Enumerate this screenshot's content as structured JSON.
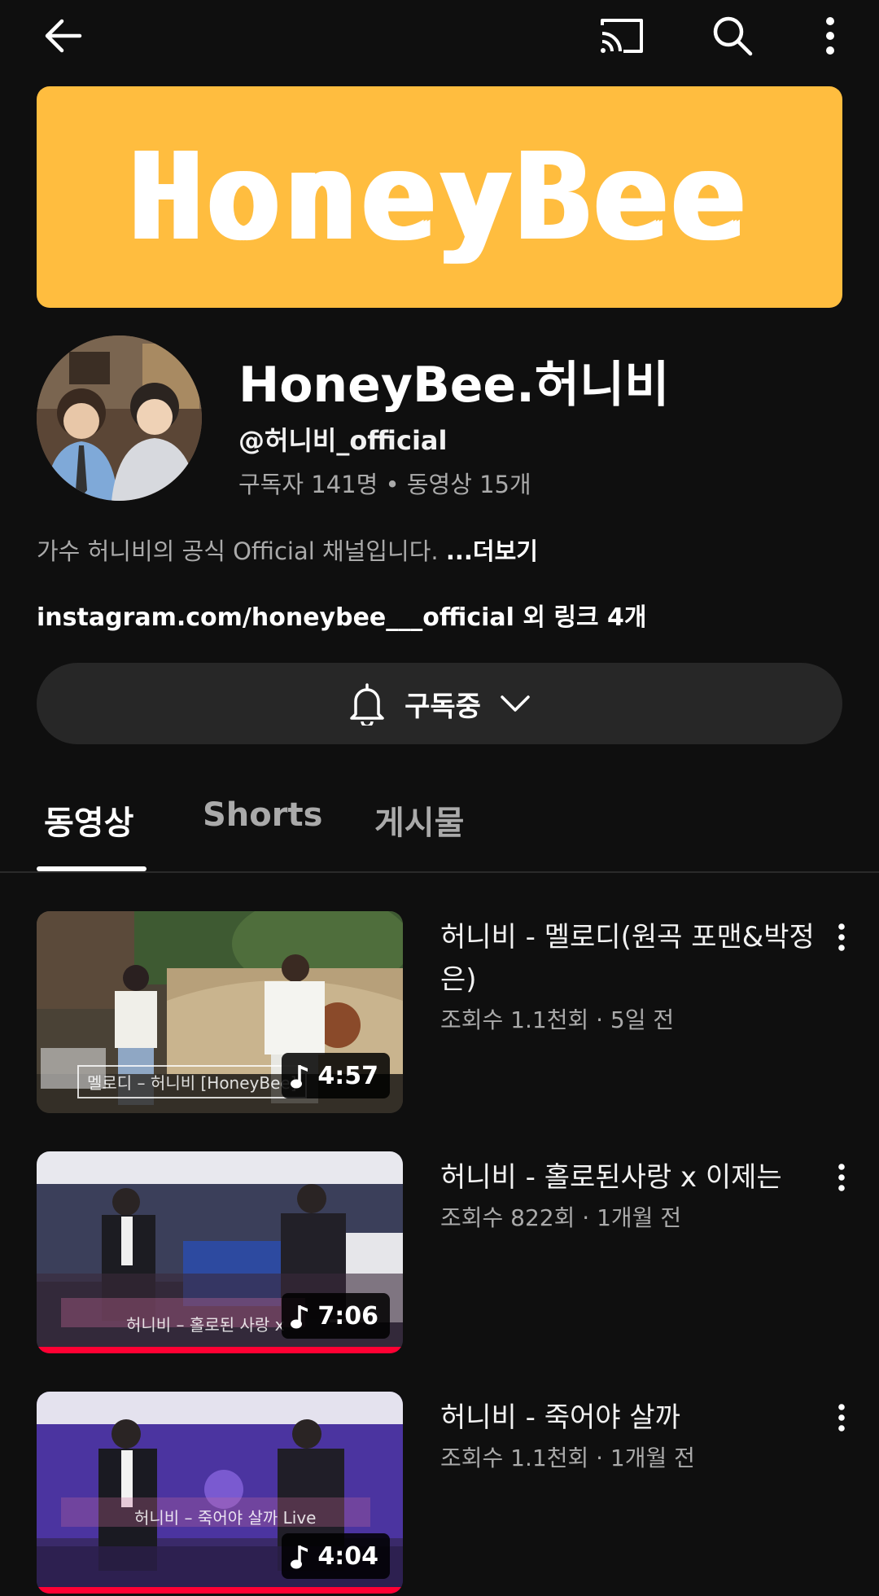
{
  "topbar": {
    "back_icon": "arrow-left-icon",
    "cast_icon": "cast-icon",
    "search_icon": "search-icon",
    "more_icon": "more-vertical-icon"
  },
  "banner": {
    "logo_text": "HoneyBee",
    "bg_color": "#ffbd3f"
  },
  "channel": {
    "name": "HoneyBee.허니비",
    "handle": "@허니비_official",
    "stats": "구독자 141명 • 동영상 15개",
    "description": "가수 허니비의 공식 Official 채널입니다. ",
    "description_more": "...더보기",
    "links": "instagram.com/honeybee___official 외 링크 4개"
  },
  "subscribe": {
    "label": "구독중",
    "bell_icon": "bell-icon",
    "chevron_icon": "chevron-down-icon"
  },
  "tabs": [
    {
      "label": "동영상",
      "active": true
    },
    {
      "label": "Shorts",
      "active": false
    },
    {
      "label": "게시물",
      "active": false
    }
  ],
  "videos": [
    {
      "title": "허니비 - 멜로디(원곡 포맨&박정은)",
      "meta": "조회수 1.1천회 · 5일 전",
      "duration": "4:57",
      "caption": "멜로디 – 허니비 [HoneyBee]"
    },
    {
      "title": "허니비 - 홀로된사랑 x 이제는",
      "meta": "조회수 822회 · 1개월 전",
      "duration": "7:06",
      "caption": "허니비 – 홀로된 사랑 x"
    },
    {
      "title": "허니비 - 죽어야 살까",
      "meta": "조회수 1.1천회 · 1개월 전",
      "duration": "4:04",
      "caption": "허니비 – 죽어야 살까 Live"
    }
  ],
  "colors": {
    "background": "#0f0f0f",
    "secondary_text": "#aaaaaa",
    "button_bg": "#272727",
    "progress": "#ff0033"
  }
}
